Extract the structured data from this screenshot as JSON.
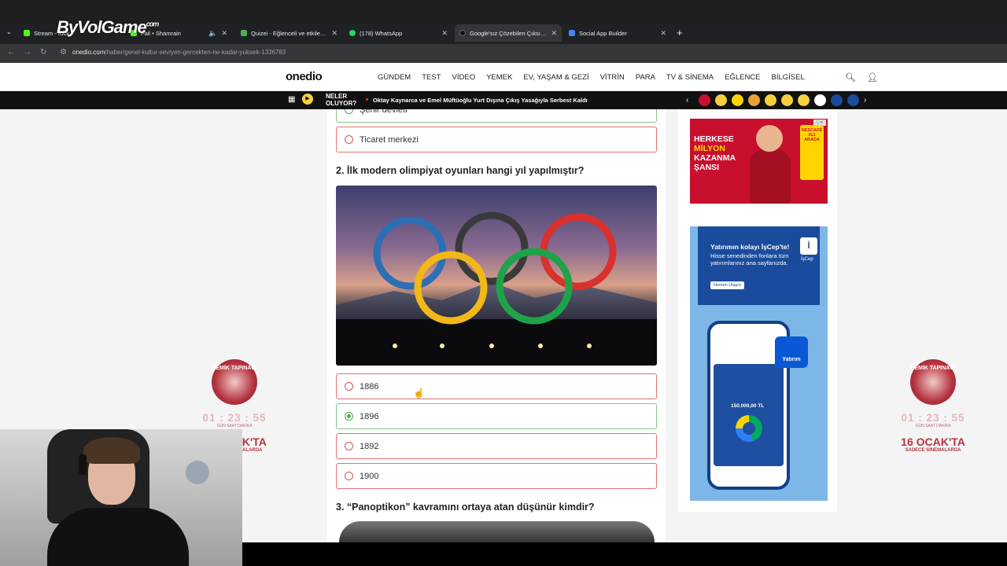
{
  "browser": {
    "tabs": [
      {
        "title": "Stream - Kick",
        "fav": "#53fc18"
      },
      {
        "title": "Fail • Shamrain",
        "fav": "#53fc18"
      },
      {
        "title": "Quizei - Eğlenceli ve etkileşimli",
        "fav": "#4caf50"
      },
      {
        "title": "(178) WhatsApp",
        "fav": "#25d366"
      },
      {
        "title": "Google'sız Çözebilen Çıksın: Zo",
        "fav": "#111111"
      },
      {
        "title": "Social App Builder",
        "fav": "#4285f4"
      }
    ],
    "url_host": "onedio.com",
    "url_path": "/haber/genel-kultur-seviyen-gercekten-ne-kadar-yuksek-1336783"
  },
  "overlay_logo": {
    "text": "ByVolGame",
    "suffix": "com"
  },
  "site": {
    "brand": "onedio",
    "menu": [
      "GÜNDEM",
      "TEST",
      "VİDEO",
      "YEMEK",
      "EV, YAŞAM & GEZİ",
      "VİTRİN",
      "PARA",
      "TV & SİNEMA",
      "EĞLENCE",
      "BİLGİSEL"
    ],
    "search_icon": "search-icon",
    "user_icon": "user-icon"
  },
  "ticker": {
    "label_line1": "NELER",
    "label_line2": "OLUYOR?",
    "headline": "Oktay Kaynarca ve Emel Müftüoğlu Yurt Dışına Çıkış Yasağıyla Serbest Kaldı",
    "emoji_colors": [
      "#c8102e",
      "#f4d03f",
      "#ffd400",
      "#e8a23a",
      "#f4d03f",
      "#f4d03f",
      "#f4d03f",
      "#ffffff",
      "#1a4b9c",
      "#1a4b9c"
    ]
  },
  "quiz": {
    "prev_options": [
      {
        "label": "Şehir devleti",
        "state": "correct",
        "selected": false
      },
      {
        "label": "Ticaret merkezi",
        "state": "wrong",
        "selected": false
      }
    ],
    "q2": {
      "title": "2. İlk modern olimpiyat oyunları hangi yıl yapılmıştır?",
      "options": [
        {
          "label": "1886",
          "state": "wrong",
          "selected": false
        },
        {
          "label": "1896",
          "state": "correct",
          "selected": true
        },
        {
          "label": "1892",
          "state": "wrong",
          "selected": false
        },
        {
          "label": "1900",
          "state": "wrong",
          "selected": false
        }
      ]
    },
    "q3": {
      "title": "3. “Panoptikon” kavramını ortaya atan düşünür kimdir?"
    }
  },
  "ads": {
    "nescafe": {
      "line1": "HERKESE",
      "line2": "MİLYON",
      "line3": "KAZANMA",
      "line4": "ŞANSI",
      "brand": "NESCAFÉ 3ü1 ARADA"
    },
    "iscep": {
      "headline": "Yatırımın kolayı İşCep'te!",
      "sub": "Hisse senedinden fonlara tüm yatırımlarınız ana sayfanızda.",
      "button": "Hemen Ulaşın",
      "bank_label": "İşCep",
      "balance": "150.000,00 TL",
      "tab_label": "Yatırım"
    }
  },
  "side_ads": {
    "emblem": "KEMİK TAPINAĞI",
    "timer": "01 : 23 : 55",
    "timer_labels": "GÜN SAAT DAKİKA",
    "date": "16 OCAK'TA",
    "sub": "SADECE SİNEMALARDA"
  }
}
